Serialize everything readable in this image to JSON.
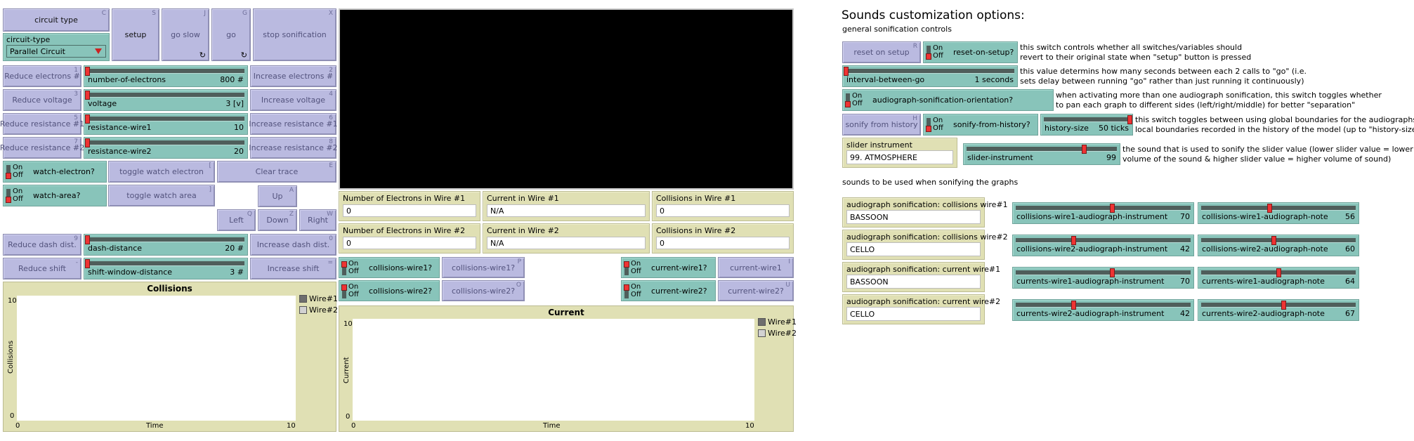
{
  "left": {
    "buttons": {
      "circuit_type": {
        "label": "circuit type",
        "key": "C"
      },
      "setup": {
        "label": "setup",
        "key": "S"
      },
      "go_slow": {
        "label": "go slow",
        "key": "J"
      },
      "go": {
        "label": "go",
        "key": "G"
      },
      "stop_sonification": {
        "label": "stop sonification",
        "key": "X"
      },
      "reduce_electrons": {
        "label": "Reduce electrons #",
        "key": "1"
      },
      "increase_electrons": {
        "label": "Increase electrons #",
        "key": "2"
      },
      "reduce_voltage": {
        "label": "Reduce voltage",
        "key": "3"
      },
      "increase_voltage": {
        "label": "Increase voltage",
        "key": "4"
      },
      "reduce_resistance1": {
        "label": "Reduce resistance #1",
        "key": "5"
      },
      "increase_resistance1": {
        "label": "Increase resistance #1",
        "key": "6"
      },
      "reduce_resistance2": {
        "label": "Reduce resistance #2",
        "key": "7"
      },
      "increase_resistance2": {
        "label": "Increase resistance #2",
        "key": "8"
      },
      "toggle_watch_electron": {
        "label": "toggle watch electron",
        "key": "["
      },
      "clear_trace": {
        "label": "Clear trace",
        "key": "E"
      },
      "toggle_watch_area": {
        "label": "toggle watch area",
        "key": "]"
      },
      "up": {
        "label": "Up",
        "key": "A"
      },
      "left": {
        "label": "Left",
        "key": "Q"
      },
      "down": {
        "label": "Down",
        "key": "Z"
      },
      "right": {
        "label": "Right",
        "key": "W"
      },
      "reduce_dash": {
        "label": "Reduce dash dist.",
        "key": "9"
      },
      "increase_dash": {
        "label": "Increase dash dist.",
        "key": "0"
      },
      "reduce_shift": {
        "label": "Reduce shift",
        "key": "-"
      },
      "increase_shift": {
        "label": "Increase shift",
        "key": "="
      }
    },
    "chooser": {
      "label": "circuit-type",
      "value": "Parallel Circuit"
    },
    "sliders": {
      "number_of_electrons": {
        "label": "number-of-electrons",
        "value": "800 #",
        "level": 0.0
      },
      "voltage": {
        "label": "voltage",
        "value": "3 [v]",
        "level": 0.0
      },
      "resistance_wire1": {
        "label": "resistance-wire1",
        "value": "10",
        "level": 0.0
      },
      "resistance_wire2": {
        "label": "resistance-wire2",
        "value": "20",
        "level": 0.0
      },
      "dash_distance": {
        "label": "dash-distance",
        "value": "20 #",
        "level": 0.0
      },
      "shift_window_distance": {
        "label": "shift-window-distance",
        "value": "3 #",
        "level": 0.0
      }
    },
    "switches": {
      "watch_electron": {
        "label": "watch-electron?",
        "on": "On",
        "off": "Off",
        "state": "off"
      },
      "watch_area": {
        "label": "watch-area?",
        "on": "On",
        "off": "Off",
        "state": "off"
      }
    },
    "collisions_plot": {
      "title": "Collisions",
      "ylabel": "Collisions",
      "xlabel": "Time",
      "ymax": "10",
      "ymin": "0",
      "xmin": "0",
      "xmax": "10",
      "legend": [
        {
          "name": "Wire#1",
          "color": "#6e6e6e"
        },
        {
          "name": "Wire#2",
          "color": "#d2d2d2"
        }
      ]
    }
  },
  "middle": {
    "monitors": [
      {
        "label": "Number of Electrons in Wire #1",
        "value": "0"
      },
      {
        "label": "Current in Wire #1",
        "value": "N/A"
      },
      {
        "label": "Collisions in Wire #1",
        "value": "0"
      },
      {
        "label": "Number of Electrons in Wire #2",
        "value": "0"
      },
      {
        "label": "Current in Wire #2",
        "value": "N/A"
      },
      {
        "label": "Collisions in Wire #2",
        "value": "0"
      }
    ],
    "switches": {
      "collisions_wire1": {
        "label": "collisions-wire1?",
        "on": "On",
        "off": "Off"
      },
      "collisions_wire2": {
        "label": "collisions-wire2?",
        "on": "On",
        "off": "Off"
      },
      "current_wire1": {
        "label": "current-wire1?",
        "on": "On",
        "off": "Off"
      },
      "current_wire2": {
        "label": "current-wire2?",
        "on": "On",
        "off": "Off"
      }
    },
    "buttons": {
      "collisions_wire1": {
        "label": "collisions-wire1?",
        "key": "P"
      },
      "collisions_wire2": {
        "label": "collisions-wire2?",
        "key": "O"
      },
      "current_wire1": {
        "label": "current-wire1",
        "key": "I"
      },
      "current_wire2": {
        "label": "current-wire2?",
        "key": "U"
      }
    },
    "current_plot": {
      "title": "Current",
      "ylabel": "Current",
      "xlabel": "Time",
      "ymax": "10",
      "ymin": "0",
      "xmin": "0",
      "xmax": "10",
      "legend": [
        {
          "name": "Wire#1",
          "color": "#6e6e6e"
        },
        {
          "name": "Wire#2",
          "color": "#d2d2d2"
        }
      ]
    }
  },
  "right": {
    "title": "Sounds customization options:",
    "subtitle": "general sonification controls",
    "reset_on_setup_button": {
      "label": "reset on setup",
      "key": "R"
    },
    "reset_on_setup_switch": {
      "label": "reset-on-setup?",
      "on": "On",
      "off": "Off"
    },
    "note_reset": [
      "this switch controls whether all switches/variables should",
      "revert to their original state when \"setup\" button is pressed"
    ],
    "interval_slider": {
      "label": "interval-between-go",
      "value": "1 seconds",
      "level": 0.0
    },
    "note_interval": [
      "this value determins how many seconds between each 2 calls to \"go\" (i.e.",
      "sets delay between running \"go\" rather than just running it continuously)"
    ],
    "orientation_switch": {
      "label": "audiograph-sonification-orientation?",
      "on": "On",
      "off": "Off"
    },
    "note_orientation": [
      "when activating more than one audiograph sonification, this switch toggles whether",
      "to pan each graph to different sides (left/right/middle) for better \"separation\""
    ],
    "sonify_history_button": {
      "label": "sonify from history",
      "key": "H"
    },
    "sonify_history_switch": {
      "label": "sonify-from-history?",
      "on": "On",
      "off": "Off"
    },
    "history_size_slider": {
      "label": "history-size",
      "value": "50 ticks",
      "level": 1.0
    },
    "note_history": [
      "this switch toggles between using global boundaries for the audiographs and",
      "local boundaries recorded in the history of the model (up to \"history-size\" ago)"
    ],
    "slider_instrument_input": {
      "label": "slider instrument",
      "value": "99. ATMOSPHERE"
    },
    "slider_instrument_slider": {
      "label": "slider-instrument",
      "value": "99",
      "level": 0.78
    },
    "note_slider_instrument": [
      "the sound that is used to sonify the slider value (lower slider value = lower",
      "volume of the sound & higher slider value = higher volume of sound)"
    ],
    "graphs_caption": "sounds to be used when sonifying the graphs",
    "audiographs": [
      {
        "input_label": "audiograph sonification: collisions wire#1",
        "input_value": "BASSOON",
        "instrument_label": "collisions-wire1-audiograph-instrument",
        "instrument_value": "70",
        "instrument_level": 0.55,
        "note_label": "collisions-wire1-audiograph-note",
        "note_value": "56",
        "note_level": 0.44
      },
      {
        "input_label": "audiograph sonification: collisions wire#2",
        "input_value": "CELLO",
        "instrument_label": "collisions-wire2-audiograph-instrument",
        "instrument_value": "42",
        "instrument_level": 0.33,
        "note_label": "collisions-wire2-audiograph-note",
        "note_value": "60",
        "note_level": 0.47
      },
      {
        "input_label": "audiograph sonification: current wire#1",
        "input_value": "BASSOON",
        "instrument_label": "currents-wire1-audiograph-instrument",
        "instrument_value": "70",
        "instrument_level": 0.55,
        "note_label": "currents-wire1-audiograph-note",
        "note_value": "64",
        "note_level": 0.5
      },
      {
        "input_label": "audiograph sonification: current wire#2",
        "input_value": "CELLO",
        "instrument_label": "currents-wire2-audiograph-instrument",
        "instrument_value": "42",
        "instrument_level": 0.33,
        "note_label": "currents-wire2-audiograph-note",
        "note_value": "67",
        "note_level": 0.53
      }
    ]
  }
}
